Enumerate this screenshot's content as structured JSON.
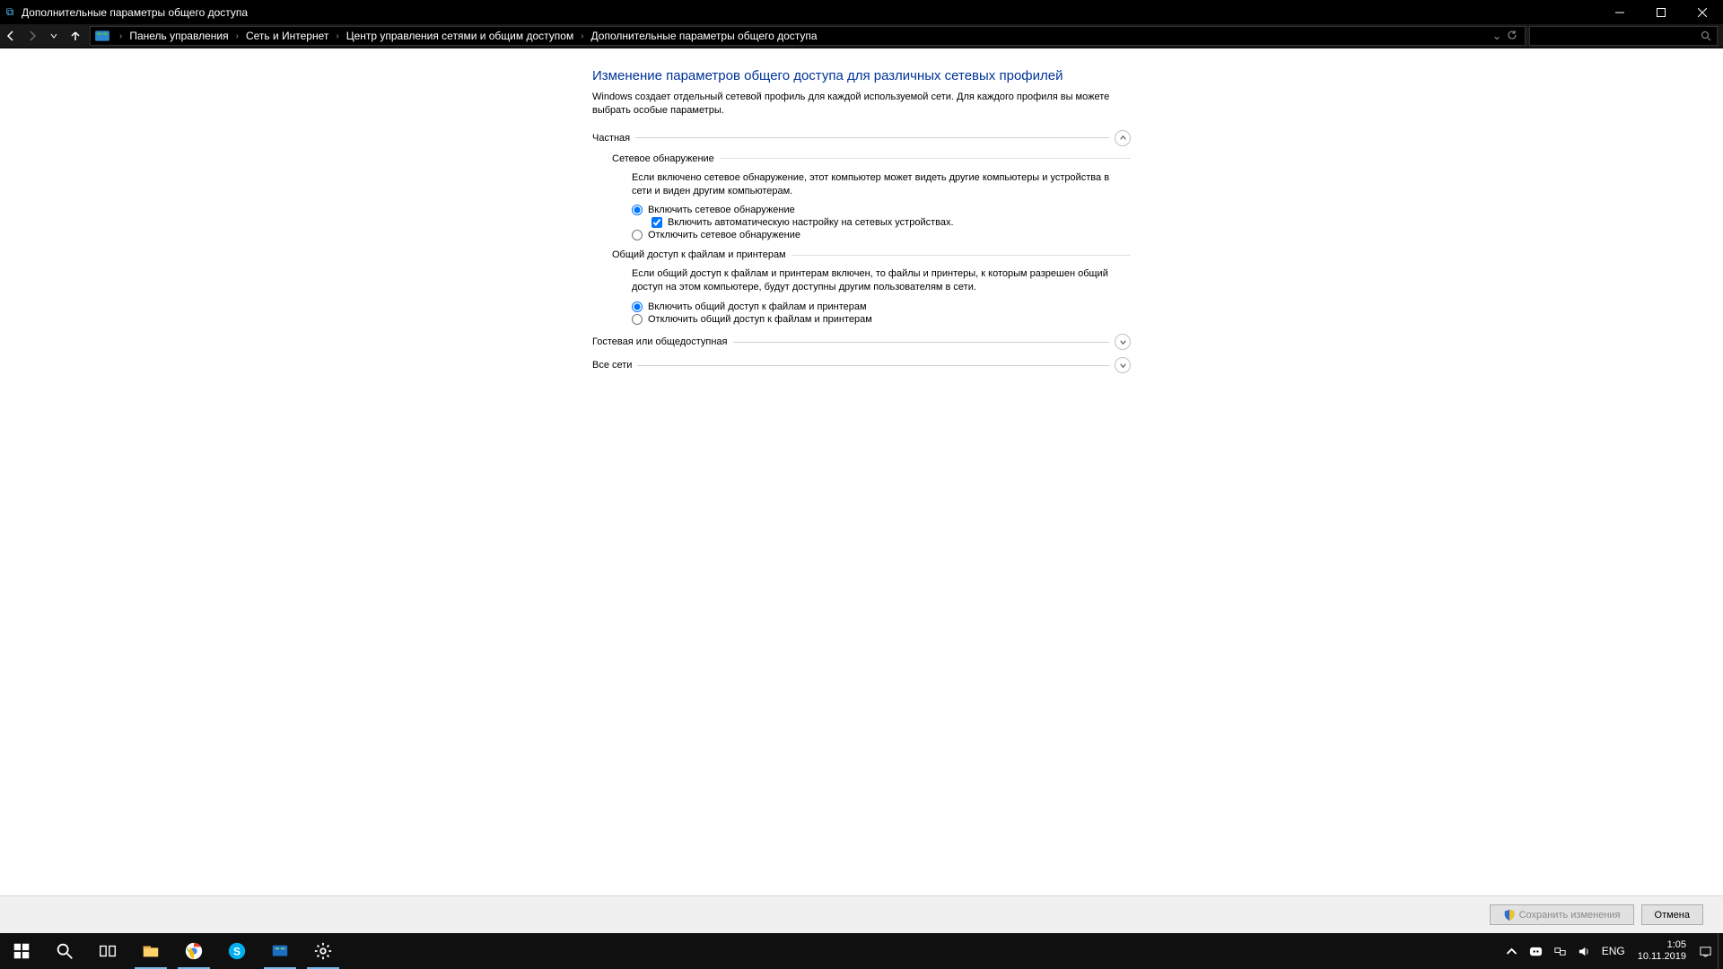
{
  "titlebar": {
    "title": "Дополнительные параметры общего доступа"
  },
  "breadcrumb": {
    "items": [
      "Панель управления",
      "Сеть и Интернет",
      "Центр управления сетями и общим доступом",
      "Дополнительные параметры общего доступа"
    ]
  },
  "page": {
    "title": "Изменение параметров общего доступа для различных сетевых профилей",
    "desc": "Windows создает отдельный сетевой профиль для каждой используемой сети. Для каждого профиля вы можете выбрать особые параметры."
  },
  "sections": {
    "private_label": "Частная",
    "guest_label": "Гостевая или общедоступная",
    "all_label": "Все сети"
  },
  "network_discovery": {
    "title": "Сетевое обнаружение",
    "desc": "Если включено сетевое обнаружение, этот компьютер может видеть другие компьютеры и устройства в сети и виден другим компьютерам.",
    "opt_on": "Включить сетевое обнаружение",
    "opt_auto": "Включить автоматическую настройку на сетевых устройствах.",
    "opt_off": "Отключить сетевое обнаружение"
  },
  "file_sharing": {
    "title": "Общий доступ к файлам и принтерам",
    "desc": "Если общий доступ к файлам и принтерам включен, то файлы и принтеры, к которым разрешен общий доступ на этом компьютере, будут доступны другим пользователям в сети.",
    "opt_on": "Включить общий доступ к файлам и принтерам",
    "opt_off": "Отключить общий доступ к файлам и принтерам"
  },
  "footer": {
    "save": "Сохранить изменения",
    "cancel": "Отмена"
  },
  "taskbar": {
    "lang": "ENG",
    "time": "1:05",
    "date": "10.11.2019"
  }
}
